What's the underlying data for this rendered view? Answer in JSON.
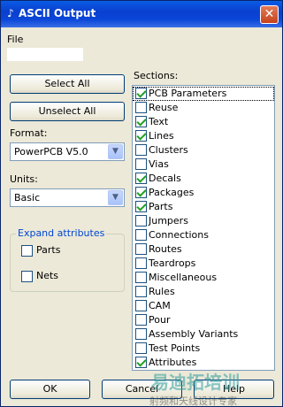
{
  "window": {
    "title": "ASCII Output",
    "title_icon": "ascii-glyph-icon",
    "close_symbol": "✕"
  },
  "file": {
    "label": "File",
    "value": ""
  },
  "buttons": {
    "select_all": "Select All",
    "unselect_all": "Unselect All",
    "ok": "OK",
    "cancel": "Cancel",
    "help": "Help"
  },
  "format": {
    "label": "Format:",
    "value": "PowerPCB V5.0"
  },
  "units": {
    "label": "Units:",
    "value": "Basic"
  },
  "expand": {
    "caption": "Expand attributes",
    "parts_label": "Parts",
    "parts_checked": false,
    "nets_label": "Nets",
    "nets_checked": false
  },
  "sections": {
    "label": "Sections:",
    "items": [
      {
        "label": "PCB Parameters",
        "checked": true
      },
      {
        "label": "Reuse",
        "checked": false
      },
      {
        "label": "Text",
        "checked": true
      },
      {
        "label": "Lines",
        "checked": true
      },
      {
        "label": "Clusters",
        "checked": false
      },
      {
        "label": "Vias",
        "checked": false
      },
      {
        "label": "Decals",
        "checked": true
      },
      {
        "label": "Packages",
        "checked": true
      },
      {
        "label": "Parts",
        "checked": true
      },
      {
        "label": "Jumpers",
        "checked": false
      },
      {
        "label": "Connections",
        "checked": false
      },
      {
        "label": "Routes",
        "checked": false
      },
      {
        "label": "Teardrops",
        "checked": false
      },
      {
        "label": "Miscellaneous",
        "checked": false
      },
      {
        "label": "Rules",
        "checked": false
      },
      {
        "label": "CAM",
        "checked": false
      },
      {
        "label": "Pour",
        "checked": false
      },
      {
        "label": "Assembly Variants",
        "checked": false
      },
      {
        "label": "Test Points",
        "checked": false
      },
      {
        "label": "Attributes",
        "checked": true
      }
    ]
  },
  "watermark": {
    "line1": "易迪拓培训",
    "line2": "射频和天线设计专家"
  }
}
